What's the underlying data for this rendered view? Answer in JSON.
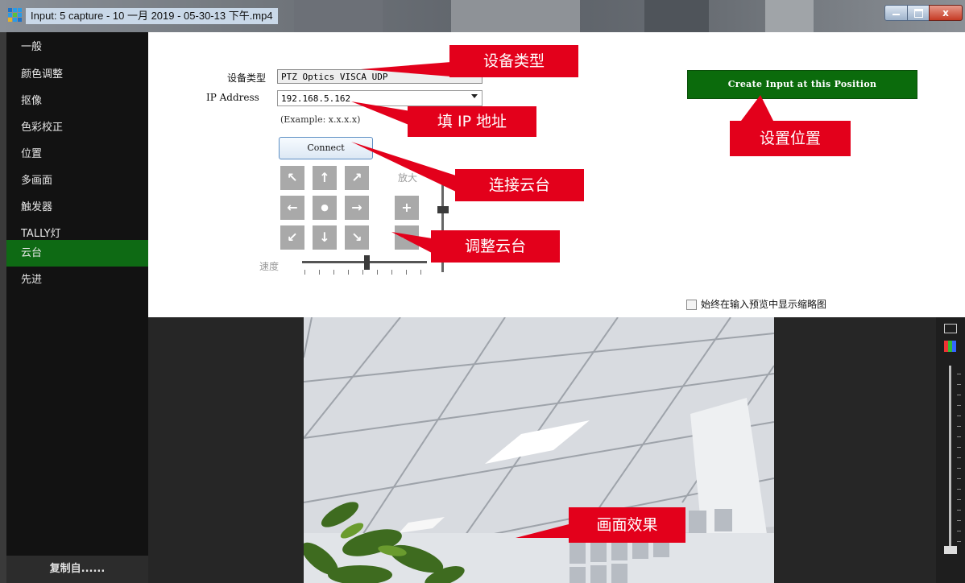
{
  "window": {
    "title": "Input: 5 capture - 10 一月 2019 - 05-30-13 下午.mp4",
    "close_glyph": "x"
  },
  "sidebar": {
    "items": [
      {
        "label": "一般"
      },
      {
        "label": "颜色调整"
      },
      {
        "label": "抠像"
      },
      {
        "label": "色彩校正"
      },
      {
        "label": "位置"
      },
      {
        "label": "多画面"
      },
      {
        "label": "触发器"
      },
      {
        "label": "TALLY灯"
      },
      {
        "label": "云台",
        "active": true
      },
      {
        "label": "先进"
      }
    ],
    "copy_from": "复制自......"
  },
  "ptz": {
    "device_type_label": "设备类型",
    "device_type_value": "PTZ Optics VISCA UDP",
    "ip_label": "IP Address",
    "ip_value": "192.168.5.162",
    "ip_example": "(Example: x.x.x.x)",
    "connect": "Connect",
    "zoom_label": "放大",
    "zoom_in": "+",
    "zoom_out": "−",
    "speed_label": "速度",
    "speed_level": 0.52,
    "pad": [
      "↖",
      "↑",
      "↗",
      "←",
      "●",
      "→",
      "↙",
      "↓",
      "↘"
    ]
  },
  "create_position": "Create Input at this Position",
  "thumbnail_option": "始终在输入预览中显示缩略图",
  "annotations": {
    "device_type": "设备类型",
    "fill_ip": "填 IP 地址",
    "set_position": "设置位置",
    "connect_ptz": "连接云台",
    "adjust_ptz": "调整云台",
    "preview_effect": "画面效果"
  },
  "colors": {
    "active_sidebar": "#0e6a14",
    "create_button": "#0b6b0c",
    "callout": "#e3001b"
  }
}
